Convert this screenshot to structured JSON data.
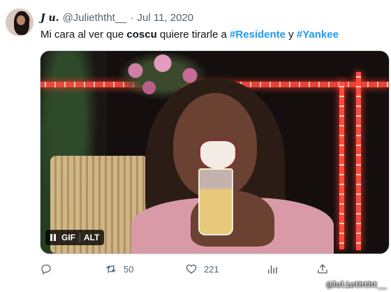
{
  "tweet": {
    "display_name": "𝑱 𝒖.",
    "handle": "@Julieththt__",
    "separator": "·",
    "date": "Jul 11, 2020",
    "text_parts": {
      "p1": "Mi cara al ver que ",
      "bold": "coscu",
      "p2": " quiere tirarle a ",
      "hashtag1": "#Residente",
      "p3": " y ",
      "hashtag2": "#Yankee"
    }
  },
  "media": {
    "badge_gif": "GIF",
    "badge_alt": "ALT"
  },
  "actions": {
    "reply_icon": "reply-icon",
    "retweet_icon": "retweet-icon",
    "retweet_count": "50",
    "like_icon": "heart-icon",
    "like_count": "221",
    "views_icon": "analytics-icon",
    "share_icon": "share-icon"
  },
  "watermark": "@Julieththt__",
  "colors": {
    "accent": "#1d9bf0",
    "muted": "#536471",
    "text": "#0f1419"
  }
}
